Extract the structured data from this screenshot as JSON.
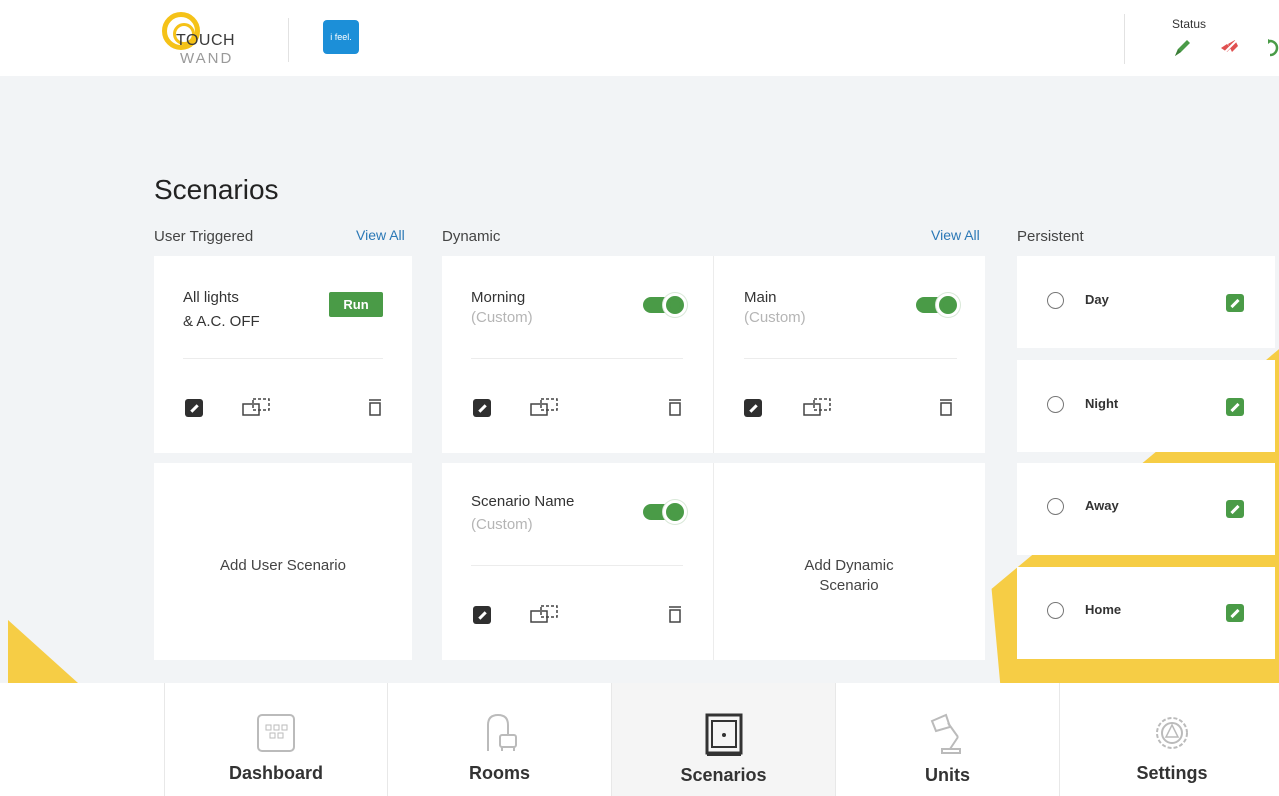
{
  "header": {
    "logo_line1": "TOUCH",
    "logo_line2": "WAND",
    "partner_logo": "i feel.",
    "status_label": "Status",
    "status_icons": [
      "pencil-icon",
      "mute-icon",
      "refresh-icon"
    ]
  },
  "page_title": "Scenarios",
  "sections": {
    "user": {
      "label": "User Triggered",
      "view_all": "View All"
    },
    "dynamic": {
      "label": "Dynamic",
      "view_all": "View All"
    },
    "persistent": {
      "label": "Persistent"
    }
  },
  "user_scenarios": [
    {
      "title_line1": "All lights",
      "title_line2": "& A.C. OFF",
      "run_label": "Run"
    }
  ],
  "add_user_scenario": "Add User Scenario",
  "dynamic_scenarios": [
    {
      "title": "Morning",
      "subtitle": "(Custom)",
      "enabled": true
    },
    {
      "title": "Main",
      "subtitle": "(Custom)",
      "enabled": true
    },
    {
      "title": "Scenario Name",
      "subtitle": "(Custom)",
      "enabled": true
    }
  ],
  "add_dynamic_scenario_line1": "Add Dynamic",
  "add_dynamic_scenario_line2": "Scenario",
  "persistent": [
    {
      "label": "Day"
    },
    {
      "label": "Night"
    },
    {
      "label": "Away"
    },
    {
      "label": "Home"
    }
  ],
  "nav": [
    {
      "label": "Dashboard",
      "icon": "dashboard-icon"
    },
    {
      "label": "Rooms",
      "icon": "rooms-icon"
    },
    {
      "label": "Scenarios",
      "icon": "scenarios-icon",
      "active": true
    },
    {
      "label": "Units",
      "icon": "units-lamp-icon"
    },
    {
      "label": "Settings",
      "icon": "settings-gear-icon"
    }
  ],
  "colors": {
    "accent_green": "#4a9b47",
    "brand_yellow": "#f5c218",
    "link_blue": "#2b78b6"
  }
}
